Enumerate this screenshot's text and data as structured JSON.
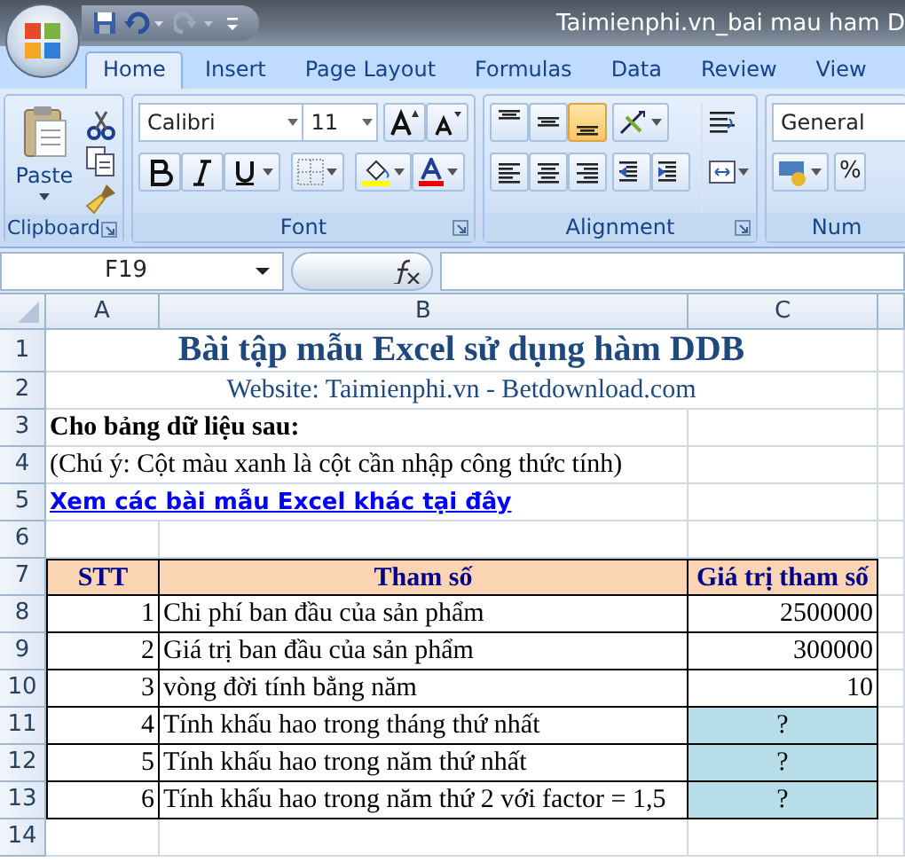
{
  "window": {
    "title": "Taimienphi.vn_bai mau ham D"
  },
  "tabs": [
    {
      "label": "Home",
      "selected": true
    },
    {
      "label": "Insert",
      "selected": false
    },
    {
      "label": "Page Layout",
      "selected": false
    },
    {
      "label": "Formulas",
      "selected": false
    },
    {
      "label": "Data",
      "selected": false
    },
    {
      "label": "Review",
      "selected": false
    },
    {
      "label": "View",
      "selected": false
    }
  ],
  "ribbon": {
    "clipboard": {
      "paste_label": "Paste",
      "label": "Clipboard"
    },
    "font": {
      "font_name": "Calibri",
      "font_size": "11",
      "label": "Font"
    },
    "alignment": {
      "vertical_align": [
        {
          "selected": false
        },
        {
          "selected": false
        },
        {
          "selected": true
        }
      ],
      "label": "Alignment"
    },
    "number": {
      "format": "General",
      "percent": "%",
      "label": "Num"
    }
  },
  "name_box": "F19",
  "columns": [
    "A",
    "B",
    "C"
  ],
  "rows": [
    {
      "number": "1",
      "kind": "title",
      "text": "Bài tập mẫu Excel sử dụng hàm DDB"
    },
    {
      "number": "2",
      "kind": "subtitle",
      "text": "Website: Taimienphi.vn - Betdownload.com"
    },
    {
      "number": "3",
      "kind": "heading",
      "text": "Cho bảng dữ liệu sau:"
    },
    {
      "number": "4",
      "kind": "note",
      "text": "(Chú ý: Cột màu xanh là cột cần nhập công thức tính)"
    },
    {
      "number": "5",
      "kind": "link",
      "text": "Xem các bài mẫu Excel khác tại đây"
    },
    {
      "number": "6",
      "kind": "empty"
    },
    {
      "number": "7",
      "kind": "header",
      "cells": [
        "STT",
        "Tham số",
        "Giá trị tham số"
      ]
    },
    {
      "number": "8",
      "kind": "data",
      "cells": [
        "1",
        "Chi phí ban đầu của sản phẩm",
        "2500000"
      ],
      "highlighted": false
    },
    {
      "number": "9",
      "kind": "data",
      "cells": [
        "2",
        "Giá trị ban đầu của sản phẩm",
        "300000"
      ],
      "highlighted": false
    },
    {
      "number": "10",
      "kind": "data",
      "cells": [
        "3",
        "vòng đời tính bằng năm",
        "10"
      ],
      "highlighted": false
    },
    {
      "number": "11",
      "kind": "data",
      "cells": [
        "4",
        "Tính khấu hao trong tháng thứ nhất",
        "?"
      ],
      "highlighted": true
    },
    {
      "number": "12",
      "kind": "data",
      "cells": [
        "5",
        "Tính khấu hao trong năm thứ nhất",
        "?"
      ],
      "highlighted": true
    },
    {
      "number": "13",
      "kind": "data",
      "cells": [
        "6",
        "Tính khấu hao trong năm thứ 2 với factor = 1,5",
        "?"
      ],
      "highlighted": true
    },
    {
      "number": "14",
      "kind": "empty"
    }
  ]
}
